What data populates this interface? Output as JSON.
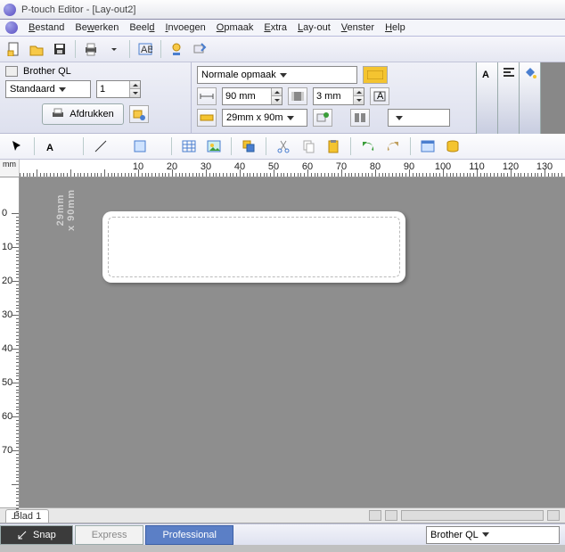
{
  "window": {
    "title": "P-touch Editor - [Lay-out2]"
  },
  "menubar": [
    "Bestand",
    "Bewerken",
    "Beeld",
    "Invoegen",
    "Opmaak",
    "Extra",
    "Lay-out",
    "Venster",
    "Help"
  ],
  "panel": {
    "printer_name": "Brother QL",
    "style_combo": "Standaard",
    "copies": "1",
    "print_button": "Afdrukken",
    "format_combo": "Normale opmaak",
    "width_value": "90 mm",
    "margin_value": "3 mm",
    "media_combo": "29mm x 90m"
  },
  "ruler": {
    "unit": "mm",
    "h_major": [
      "10",
      "20",
      "30",
      "40",
      "50",
      "60",
      "70",
      "80",
      "90",
      "100",
      "110",
      "120",
      "130"
    ],
    "v_major": [
      "0",
      "10",
      "20",
      "30",
      "40",
      "50",
      "60",
      "70"
    ]
  },
  "label": {
    "size_text_l1": "29mm",
    "size_text_l2": "x 90mm"
  },
  "sheet": {
    "tab": "Blad 1"
  },
  "bottom": {
    "snap": "Snap",
    "express": "Express",
    "professional": "Professional",
    "printer": "Brother QL"
  },
  "icons": {
    "new": "new",
    "open": "open",
    "save": "save",
    "print": "print",
    "abc": "ABC",
    "db": "db",
    "wizard": "wizard"
  }
}
